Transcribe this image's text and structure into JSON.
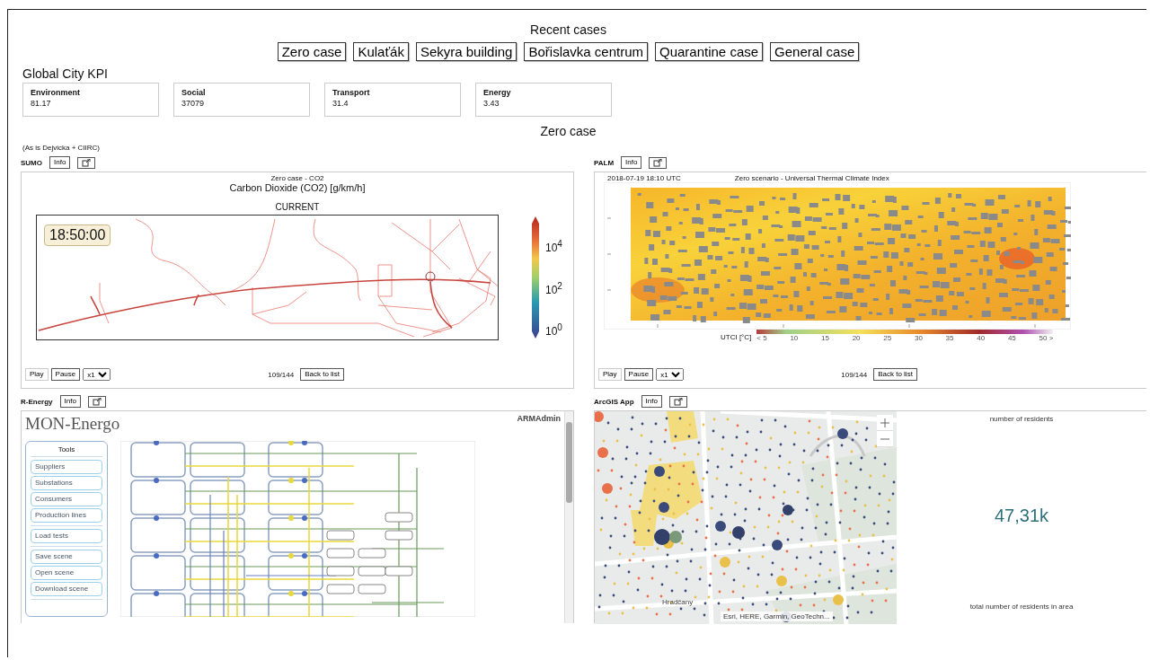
{
  "header": {
    "title": "Recent cases",
    "cases": [
      "Zero case",
      "Kulaťák",
      "Sekyra building",
      "Bořislavka centrum",
      "Quarantine case",
      "General case"
    ]
  },
  "kpi": {
    "title": "Global City KPI",
    "cards": [
      {
        "label": "Environment",
        "value": "81.17"
      },
      {
        "label": "Social",
        "value": "37079"
      },
      {
        "label": "Transport",
        "value": "31.4"
      },
      {
        "label": "Energy",
        "value": "3.43"
      }
    ]
  },
  "scenario": {
    "title": "Zero case",
    "note": "(As is Dejvicka + CIIRC)"
  },
  "sumo": {
    "name": "SUMO",
    "info_button": "Info",
    "chart_subtitle": "Zero case - CO2",
    "chart_title": "Carbon Dioxide (CO2) [g/km/h]",
    "view_label": "CURRENT",
    "time": "18:50:00",
    "colorbar_ticks": [
      "10$^{4}$",
      "10$^{2}$",
      "10$^{0}$"
    ],
    "controls": {
      "play": "Play",
      "pause": "Pause",
      "speed": "x1",
      "frame": "109/144",
      "back": "Back to list"
    }
  },
  "palm": {
    "name": "PALM",
    "info_button": "Info",
    "timestamp": "2018-07-19 18:10 UTC",
    "chart_title": "Zero scenario - Universal Thermal Climate Index",
    "legend_label": "UTCI [°C]",
    "legend_ticks": [
      "< 5",
      "10",
      "15",
      "20",
      "25",
      "30",
      "35",
      "40",
      "45",
      "50 >"
    ],
    "controls": {
      "play": "Play",
      "pause": "Pause",
      "speed": "x1",
      "frame": "109/144",
      "back": "Back to list"
    }
  },
  "r_energy": {
    "name": "R-Energy",
    "info_button": "Info",
    "app_title": "MON-Energo",
    "user": "ARMAdmin",
    "tools_title": "Tools",
    "tool_groups": [
      [
        "Suppliers",
        "Substations",
        "Consumers",
        "Production lines"
      ],
      [
        "Load tests"
      ],
      [
        "Save scene",
        "Open scene",
        "Download scene"
      ]
    ]
  },
  "arcgis": {
    "name": "ArcGIS App",
    "info_button": "Info",
    "place_label": "Hradčany",
    "attribution": "Esri, HERE, Garmin, GeoTechn...",
    "metric_title": "number of residents",
    "metric_value": "47,31k",
    "metric_caption": "total number of residents in area"
  }
}
